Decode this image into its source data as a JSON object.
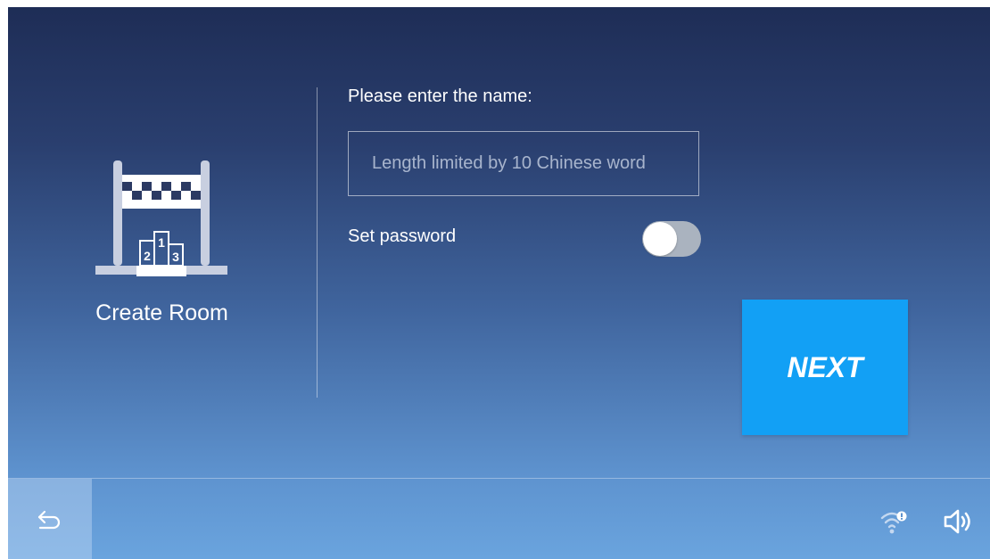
{
  "room": {
    "title": "Create Room",
    "icon": "podium-finish-icon",
    "podium_numbers": [
      "2",
      "1",
      "3"
    ]
  },
  "form": {
    "name_label": "Please enter the name:",
    "name_placeholder": "Length limited by 10 Chinese word",
    "password_label": "Set password",
    "password_enabled": false
  },
  "actions": {
    "next_label": "NEXT"
  },
  "status_bar": {
    "back_icon": "back-arrow-icon",
    "wifi_icon": "wifi-alert-icon",
    "volume_icon": "volume-icon"
  },
  "colors": {
    "next_button": "#12a0f5",
    "toggle_off": "#aab3bf",
    "background_top": "#1e2d56",
    "background_bottom": "#6aa4de"
  }
}
